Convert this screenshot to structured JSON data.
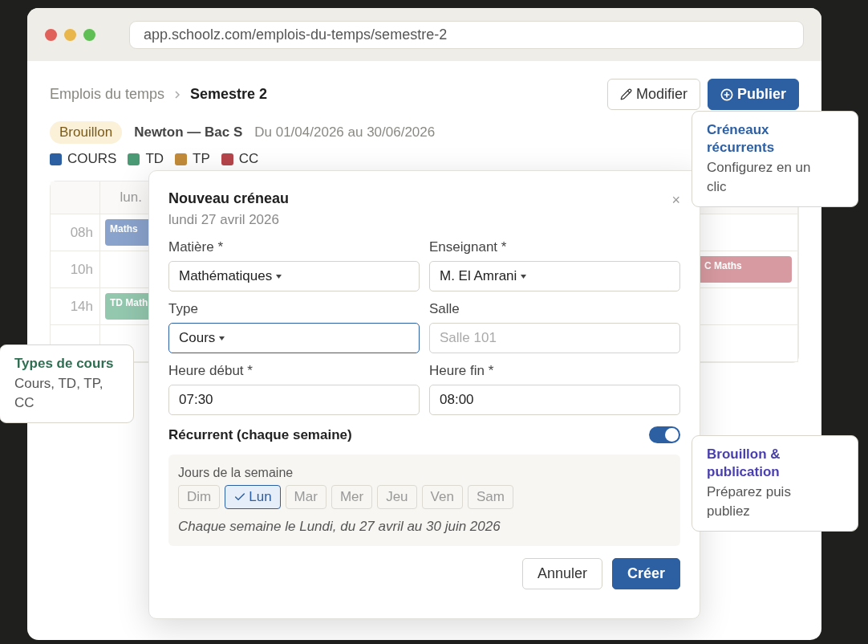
{
  "browser": {
    "url": "app.schoolz.com/emplois-du-temps/semestre-2"
  },
  "breadcrumb": [
    {
      "label": "Emplois du temps",
      "current": false
    },
    {
      "label": "Semestre 2",
      "current": true
    }
  ],
  "actions": [
    {
      "kind": "secondary",
      "label": "Modifier"
    },
    {
      "kind": "primary",
      "label": "Publier"
    }
  ],
  "status": {
    "badge": "Brouillon",
    "title": "Newton — Bac S",
    "period": "Du 01/04/2026 au 30/06/2026"
  },
  "legend": [
    {
      "label": "COURS",
      "color": "#2d5fa3"
    },
    {
      "label": "TD",
      "color": "#4a9a76"
    },
    {
      "label": "TP",
      "color": "#c28b3a"
    },
    {
      "label": "CC",
      "color": "#b5454b"
    }
  ],
  "calendar": {
    "first_day": "lun.",
    "rows": [
      {
        "time": "08h",
        "first_column": {
          "label": "Maths",
          "color": "#8aa3cc"
        }
      },
      {
        "time": "10h",
        "last_column": {
          "label": "C Maths",
          "color": "#d79aa0"
        }
      },
      {
        "time": "14h",
        "first_column": {
          "label": "TD Math",
          "color": "#93c7ae"
        }
      }
    ]
  },
  "modal": {
    "title": "Nouveau créneau",
    "date": "lundi 27 avril 2026",
    "close": "×",
    "fields": [
      {
        "label": "Matière *",
        "kind": "select",
        "value": "Mathématiques",
        "focused": false
      },
      {
        "label": "Enseignant *",
        "kind": "select",
        "value": "M. El Amrani",
        "focused": false
      },
      {
        "label": "Type",
        "kind": "select",
        "value": "Cours",
        "focused": true
      },
      {
        "label": "Salle",
        "kind": "text",
        "placeholder": "Salle 101",
        "focused": false
      },
      {
        "label": "Heure début *",
        "kind": "text",
        "value": "07:30",
        "focused": false
      },
      {
        "label": "Heure fin *",
        "kind": "text",
        "value": "08:00",
        "focused": false
      }
    ],
    "recurrent": {
      "label": "Récurrent (chaque semaine)",
      "on": true
    },
    "days": {
      "label": "Jours de la semaine",
      "items": [
        {
          "label": "Dim",
          "selected": false
        },
        {
          "label": "Lun",
          "selected": true
        },
        {
          "label": "Mar",
          "selected": false
        },
        {
          "label": "Mer",
          "selected": false
        },
        {
          "label": "Jeu",
          "selected": false
        },
        {
          "label": "Ven",
          "selected": false
        },
        {
          "label": "Sam",
          "selected": false
        }
      ],
      "summary": "Chaque semaine le Lundi, du 27 avril au 30 juin 2026"
    },
    "buttons": [
      {
        "kind": "secondary",
        "label": "Annuler"
      },
      {
        "kind": "primary",
        "label": "Créer"
      }
    ]
  },
  "callouts": [
    {
      "title": "Créneaux récurrents",
      "text": "Configurez en un clic",
      "color": "#2d5fa3"
    },
    {
      "title": "Types de cours",
      "text": "Cours, TD, TP, CC",
      "color": "#2f6e52"
    },
    {
      "title": "Brouillon & publication",
      "text": "Préparez puis publiez",
      "color": "#4a3fb0"
    }
  ]
}
